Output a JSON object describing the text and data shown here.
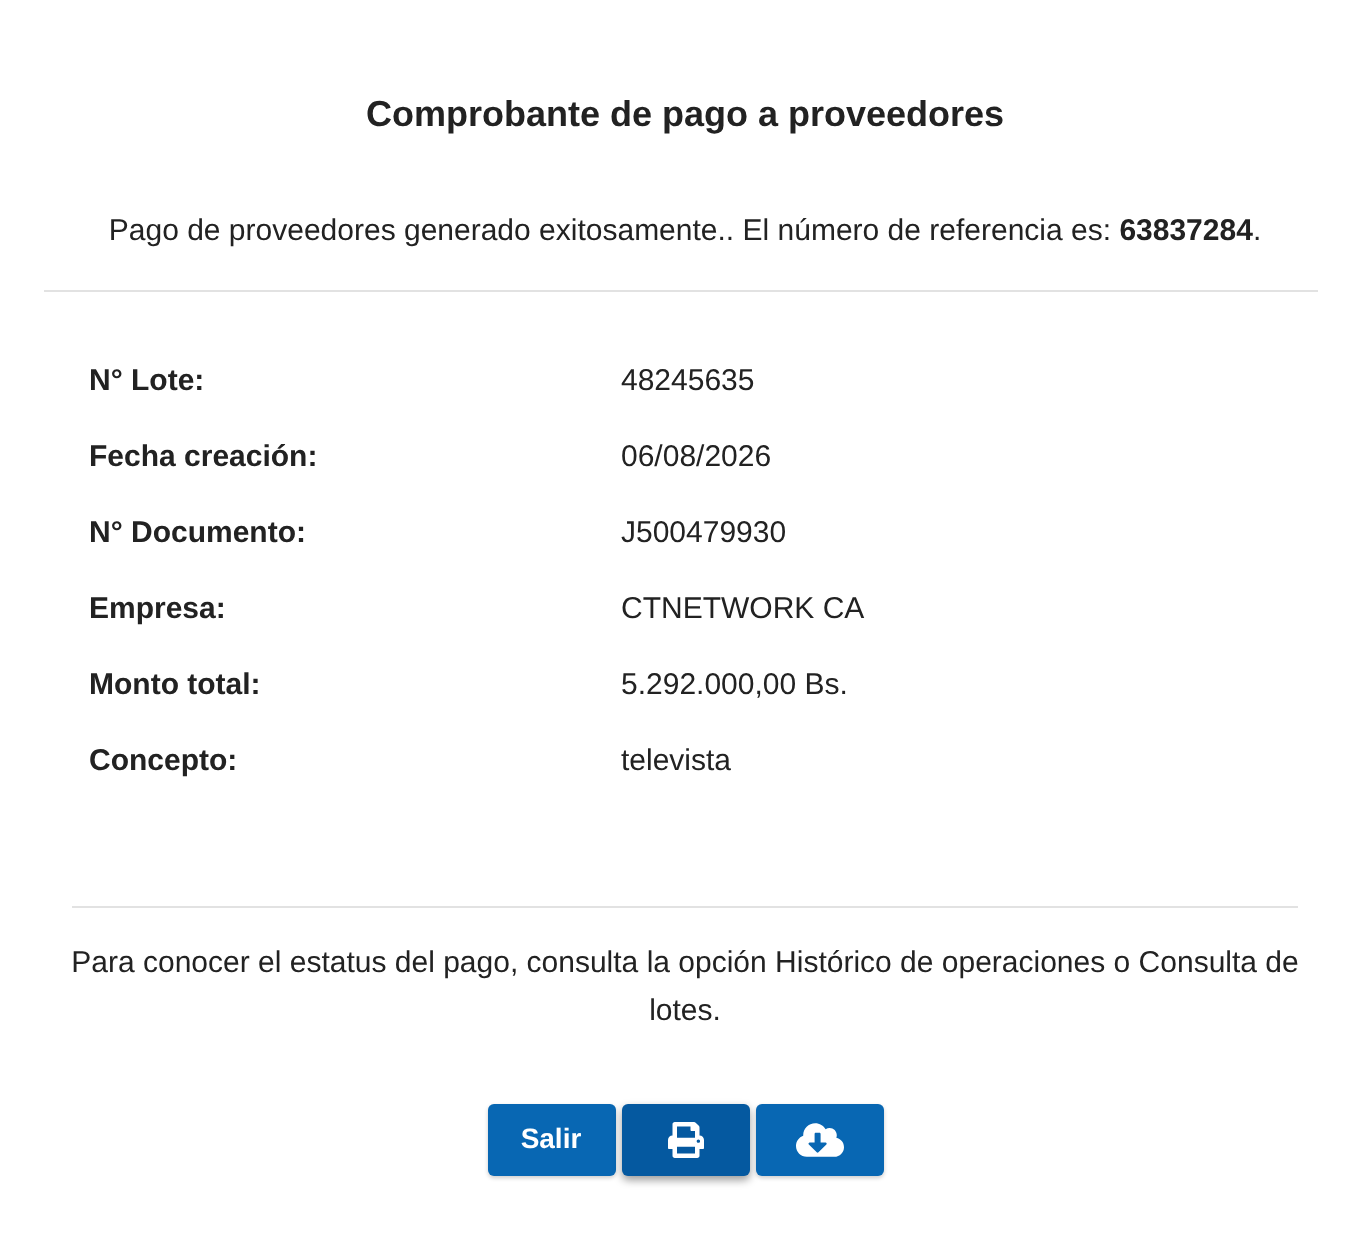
{
  "title": "Comprobante de pago a proveedores",
  "message": "Pago de proveedores generado exitosamente.. El número de referencia es: **63837284**.",
  "details": [
    {
      "label": "N° Lote:",
      "value": "48245635"
    },
    {
      "label": "Fecha creación:",
      "value": "06/08/2026"
    },
    {
      "label": "N° Documento:",
      "value": "J500479930"
    },
    {
      "label": "Empresa:",
      "value": "CTNETWORK CA"
    },
    {
      "label": "Monto total:",
      "value": "5.292.000,00 Bs."
    },
    {
      "label": "Concepto:",
      "value": "televista"
    }
  ],
  "note": "Para conocer el estatus del pago, consulta la opción Histórico de operaciones o Consulta de lotes.",
  "buttons": [
    {
      "kind": "text",
      "label": "Salir",
      "focused": false
    },
    {
      "kind": "print",
      "focused": true
    },
    {
      "kind": "download",
      "focused": false
    }
  ]
}
